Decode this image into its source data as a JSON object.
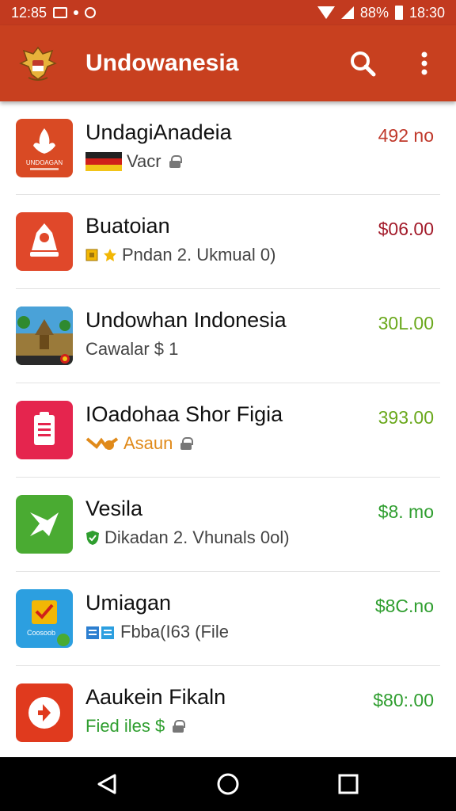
{
  "status_bar": {
    "time_left": "12:85",
    "battery": "88%",
    "clock": "18:30"
  },
  "app_bar": {
    "title": "Undowanesia",
    "search_icon": "search-icon",
    "menu_icon": "more-vert-icon",
    "color": "#c8401f"
  },
  "items": [
    {
      "title": "UndagiAnadeia",
      "subtitle": "Vacr",
      "price": "492 no",
      "price_color": "#c0392b",
      "thumb_color": "#d94a24",
      "thumb_label": "UNDOAGAN"
    },
    {
      "title": "Buatoian",
      "subtitle": "Pndan 2. Ukmual 0)",
      "price": "$06.00",
      "price_color": "#a31c2b",
      "thumb_color": "#e0482a",
      "thumb_label": ""
    },
    {
      "title": "Undowhan Indonesia",
      "subtitle": "Cawalar $ 1",
      "price": "30L.00",
      "price_color": "#6aa81c",
      "thumb_color": "#3c8a40",
      "thumb_label": ""
    },
    {
      "title": "IOadohaa Shor Figia",
      "subtitle": "Asaun",
      "price": "393.00",
      "price_color": "#6aa81c",
      "thumb_color": "#e5254e",
      "thumb_label": ""
    },
    {
      "title": "Vesila",
      "subtitle": "Dikadan 2. Vhunals 0ol)",
      "price": "$8. mo",
      "price_color": "#2f9e2f",
      "thumb_color": "#4aab32",
      "thumb_label": ""
    },
    {
      "title": "Umiagan",
      "subtitle": "Fbba(I63 (File",
      "price": "$8C.no",
      "price_color": "#2f9e2f",
      "thumb_color": "#2c9fe0",
      "thumb_label": "Coosoob"
    },
    {
      "title": "Aaukein Fikaln",
      "subtitle": "Fied iles $",
      "price": "$80:.00",
      "price_color": "#2f9e2f",
      "thumb_color": "#e03a1e",
      "thumb_label": ""
    }
  ],
  "nav_bar": {
    "back_icon": "back-icon",
    "home_icon": "home-icon",
    "recents_icon": "recents-icon"
  }
}
